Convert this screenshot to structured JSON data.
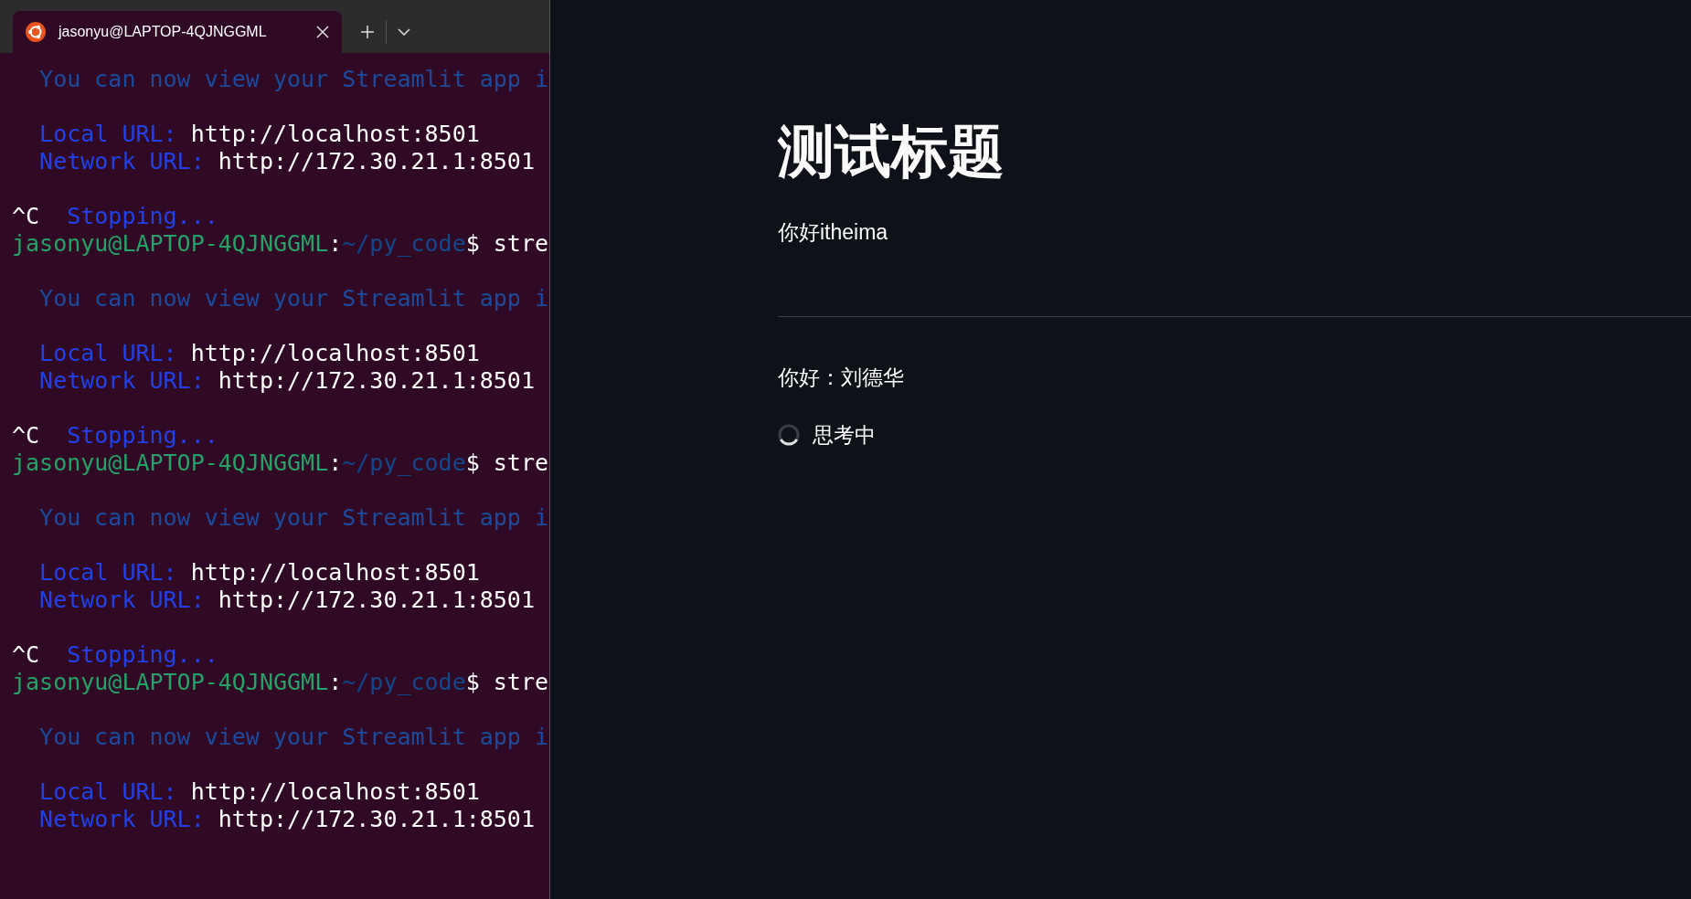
{
  "terminal": {
    "tabs": [
      {
        "title": "jasonyu@LAPTOP-4QJNGGML",
        "selected": true
      }
    ],
    "lines": [
      {
        "kind": "text",
        "segments": [
          {
            "kind": "info",
            "text": "  You can now view your Streamlit app i"
          }
        ]
      },
      {
        "kind": "blank"
      },
      {
        "kind": "text",
        "segments": [
          {
            "kind": "label",
            "text": "  Local URL:"
          },
          {
            "kind": "plain",
            "text": " http://localhost:8501"
          }
        ]
      },
      {
        "kind": "text",
        "segments": [
          {
            "kind": "label",
            "text": "  Network URL:"
          },
          {
            "kind": "plain",
            "text": " http://172.30.21.1:8501"
          }
        ]
      },
      {
        "kind": "blank"
      },
      {
        "kind": "text",
        "segments": [
          {
            "kind": "plain",
            "text": "^C"
          },
          {
            "kind": "label",
            "text": "  Stopping..."
          }
        ]
      },
      {
        "kind": "text",
        "segments": [
          {
            "kind": "user",
            "text": "jasonyu@LAPTOP-4QJNGGML"
          },
          {
            "kind": "plain",
            "text": ":"
          },
          {
            "kind": "path",
            "text": "~/py_code"
          },
          {
            "kind": "plain",
            "text": "$ stre"
          }
        ]
      },
      {
        "kind": "blank"
      },
      {
        "kind": "text",
        "segments": [
          {
            "kind": "info",
            "text": "  You can now view your Streamlit app i"
          }
        ]
      },
      {
        "kind": "blank"
      },
      {
        "kind": "text",
        "segments": [
          {
            "kind": "label",
            "text": "  Local URL:"
          },
          {
            "kind": "plain",
            "text": " http://localhost:8501"
          }
        ]
      },
      {
        "kind": "text",
        "segments": [
          {
            "kind": "label",
            "text": "  Network URL:"
          },
          {
            "kind": "plain",
            "text": " http://172.30.21.1:8501"
          }
        ]
      },
      {
        "kind": "blank"
      },
      {
        "kind": "text",
        "segments": [
          {
            "kind": "plain",
            "text": "^C"
          },
          {
            "kind": "label",
            "text": "  Stopping..."
          }
        ]
      },
      {
        "kind": "text",
        "segments": [
          {
            "kind": "user",
            "text": "jasonyu@LAPTOP-4QJNGGML"
          },
          {
            "kind": "plain",
            "text": ":"
          },
          {
            "kind": "path",
            "text": "~/py_code"
          },
          {
            "kind": "plain",
            "text": "$ stre"
          }
        ]
      },
      {
        "kind": "blank"
      },
      {
        "kind": "text",
        "segments": [
          {
            "kind": "info",
            "text": "  You can now view your Streamlit app i"
          }
        ]
      },
      {
        "kind": "blank"
      },
      {
        "kind": "text",
        "segments": [
          {
            "kind": "label",
            "text": "  Local URL:"
          },
          {
            "kind": "plain",
            "text": " http://localhost:8501"
          }
        ]
      },
      {
        "kind": "text",
        "segments": [
          {
            "kind": "label",
            "text": "  Network URL:"
          },
          {
            "kind": "plain",
            "text": " http://172.30.21.1:8501"
          }
        ]
      },
      {
        "kind": "blank"
      },
      {
        "kind": "text",
        "segments": [
          {
            "kind": "plain",
            "text": "^C"
          },
          {
            "kind": "label",
            "text": "  Stopping..."
          }
        ]
      },
      {
        "kind": "text",
        "segments": [
          {
            "kind": "user",
            "text": "jasonyu@LAPTOP-4QJNGGML"
          },
          {
            "kind": "plain",
            "text": ":"
          },
          {
            "kind": "path",
            "text": "~/py_code"
          },
          {
            "kind": "plain",
            "text": "$ stre"
          }
        ]
      },
      {
        "kind": "blank"
      },
      {
        "kind": "text",
        "segments": [
          {
            "kind": "info",
            "text": "  You can now view your Streamlit app i"
          }
        ]
      },
      {
        "kind": "blank"
      },
      {
        "kind": "text",
        "segments": [
          {
            "kind": "label",
            "text": "  Local URL:"
          },
          {
            "kind": "plain",
            "text": " http://localhost:8501"
          }
        ]
      },
      {
        "kind": "text",
        "segments": [
          {
            "kind": "label",
            "text": "  Network URL:"
          },
          {
            "kind": "plain",
            "text": " http://172.30.21.1:8501"
          }
        ]
      }
    ]
  },
  "app": {
    "elements": [
      {
        "kind": "title",
        "text": "测试标题"
      },
      {
        "kind": "text",
        "text": "你好itheima"
      },
      {
        "kind": "divider"
      },
      {
        "kind": "text",
        "text": "你好：刘德华"
      },
      {
        "kind": "spinner",
        "text": "思考中"
      }
    ]
  }
}
